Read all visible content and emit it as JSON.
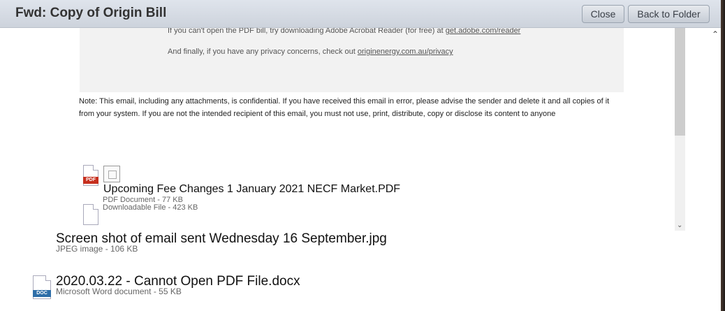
{
  "window": {
    "title": "Fwd: Copy of Origin Bill",
    "close_label": "Close",
    "back_label": "Back to Folder"
  },
  "email": {
    "acrobat_text": "If you can't open the PDF bill, try downloading Adobe Acrobat Reader (for free) at ",
    "acrobat_link": "get.adobe.com/reader",
    "privacy_text": "And finally, if you have any privacy concerns, check out ",
    "privacy_link": "originenergy.com.au/privacy",
    "note_line1": "Note: This email, including any attachments, is confidential. If you have received this email in error, please advise the sender and delete it and all copies of it",
    "note_line2": "from your system. If you are not the intended recipient of this email, you must not use, print, distribute, copy or disclose its content to anyone"
  },
  "inner_attachments": [
    {
      "name": "Upcoming Fee Changes 1 January 2021 NECF Market.PDF",
      "meta": "PDF Document - 77 KB",
      "icon": "pdf-icon",
      "badge": "PDF"
    },
    {
      "name": "",
      "meta": "Downloadable File - 423 KB",
      "icon": "file-icon"
    }
  ],
  "attachments": [
    {
      "name": "Screen shot of email sent Wednesday 16 September.jpg",
      "meta": "JPEG image - 106 KB"
    },
    {
      "name": "2020.03.22 - Cannot Open PDF File.docx",
      "meta": "Microsoft Word document - 55 KB",
      "icon": "doc-icon",
      "badge": "DOC"
    }
  ],
  "icons": {
    "scroll_up": "⌃",
    "scroll_down": "⌄"
  }
}
